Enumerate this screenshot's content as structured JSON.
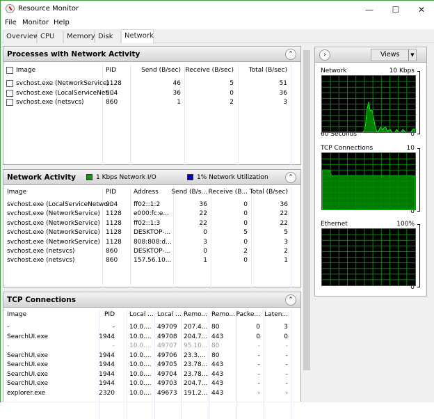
{
  "window": {
    "title": "Resource Monitor",
    "minimize": "—",
    "maximize": "☐",
    "close": "✕"
  },
  "menu": [
    "File",
    "Monitor",
    "Help"
  ],
  "tabs": [
    {
      "label": "Overview"
    },
    {
      "label": "CPU"
    },
    {
      "label": "Memory"
    },
    {
      "label": "Disk"
    },
    {
      "label": "Network",
      "active": true
    }
  ],
  "processes": {
    "title": "Processes with Network Activity",
    "columns": [
      "Image",
      "PID",
      "Send (B/sec)",
      "Receive (B/sec)",
      "Total (B/sec)"
    ],
    "rows": [
      [
        "svchost.exe (NetworkService)",
        "1128",
        "46",
        "5",
        "51"
      ],
      [
        "svchost.exe (LocalServiceNet...",
        "904",
        "36",
        "0",
        "36"
      ],
      [
        "svchost.exe (netsvcs)",
        "860",
        "1",
        "2",
        "3"
      ]
    ]
  },
  "network_activity": {
    "title": "Network Activity",
    "legend": [
      {
        "label": "1 Kbps Network I/O",
        "color": "#00a000"
      },
      {
        "label": "1% Network Utilization",
        "color": "#0000c8"
      }
    ],
    "columns": [
      "Image",
      "PID",
      "Address",
      "Send (B/s...",
      "Receive (B...",
      "Total (B/sec)"
    ],
    "rows": [
      [
        "svchost.exe (LocalServiceNetwo...",
        "904",
        "ff02::1:2",
        "36",
        "0",
        "36"
      ],
      [
        "svchost.exe (NetworkService)",
        "1128",
        "e000:fc:e...",
        "22",
        "0",
        "22"
      ],
      [
        "svchost.exe (NetworkService)",
        "1128",
        "ff02::1:3",
        "22",
        "0",
        "22"
      ],
      [
        "svchost.exe (NetworkService)",
        "1128",
        "DESKTOP-...",
        "0",
        "5",
        "5"
      ],
      [
        "svchost.exe (NetworkService)",
        "1128",
        "808:808:d...",
        "3",
        "0",
        "3"
      ],
      [
        "svchost.exe (netsvcs)",
        "860",
        "DESKTOP-...",
        "0",
        "2",
        "2"
      ],
      [
        "svchost.exe (netsvcs)",
        "860",
        "157.56.10...",
        "1",
        "0",
        "1"
      ]
    ]
  },
  "tcp": {
    "title": "TCP Connections",
    "columns": [
      "Image",
      "PID",
      "Local ...",
      "Local ...",
      "Remo...",
      "Remo...",
      "Packe...",
      "Laten..."
    ],
    "rows": [
      [
        "-",
        "-",
        "10.0....",
        "49709",
        "207.4...",
        "80",
        "0",
        "3"
      ],
      [
        "SearchUI.exe",
        "1944",
        "10.0....",
        "49708",
        "204.7...",
        "443",
        "0",
        "0"
      ],
      [
        "-",
        "-",
        "10.0....",
        "49707",
        "95.10...",
        "80",
        "-",
        "-"
      ],
      [
        "SearchUI.exe",
        "1944",
        "10.0....",
        "49706",
        "23.3....",
        "80",
        "-",
        "-"
      ],
      [
        "SearchUI.exe",
        "1944",
        "10.0....",
        "49705",
        "23.78...",
        "443",
        "-",
        "-"
      ],
      [
        "SearchUI.exe",
        "1944",
        "10.0....",
        "49704",
        "23.78...",
        "443",
        "-",
        "-"
      ],
      [
        "SearchUI.exe",
        "1944",
        "10.0....",
        "49703",
        "204.7...",
        "443",
        "-",
        "-"
      ],
      [
        "explorer.exe",
        "2320",
        "10.0....",
        "49673",
        "191.2...",
        "443",
        "-",
        "-"
      ]
    ],
    "dimmed_rows": [
      2
    ]
  },
  "right_panel": {
    "views_label": "Views",
    "graphs": [
      {
        "name": "Network",
        "max": "10 Kbps",
        "min": "0",
        "time": "60 Seconds",
        "samples": [
          0,
          0,
          0,
          0,
          0,
          0,
          0,
          0,
          0,
          0,
          0,
          0,
          0,
          0,
          0,
          0,
          0,
          0,
          0,
          0,
          0,
          0,
          0,
          0,
          0,
          0,
          0,
          2,
          12,
          42,
          53,
          38,
          40,
          28,
          14,
          3,
          0,
          6,
          10,
          4,
          8,
          9,
          2,
          4,
          5,
          0,
          0,
          0,
          5,
          2,
          0,
          0,
          5,
          2,
          0,
          0,
          0,
          0,
          3,
          6,
          4
        ]
      },
      {
        "name": "TCP Connections",
        "max": "10",
        "min": "0",
        "samples": [
          7,
          7,
          7,
          7,
          7,
          7,
          6,
          6,
          6,
          6,
          6,
          6,
          6,
          6,
          6,
          6,
          6,
          6,
          6,
          6,
          6,
          6,
          6,
          6,
          6,
          6,
          6,
          6,
          6,
          6,
          6,
          6,
          6,
          6,
          6,
          6,
          6,
          6,
          6,
          6,
          6,
          6,
          6,
          6,
          6,
          6,
          6,
          6,
          6,
          6,
          6,
          6,
          6,
          6,
          6,
          6,
          6,
          6,
          6,
          6,
          6
        ]
      },
      {
        "name": "Ethernet",
        "max": "100%",
        "min": "0",
        "samples": []
      }
    ],
    "graph_colors": {
      "line": "#00ff00",
      "fill": "#007a00",
      "grid": "#008a00",
      "bg": "#000000"
    }
  }
}
